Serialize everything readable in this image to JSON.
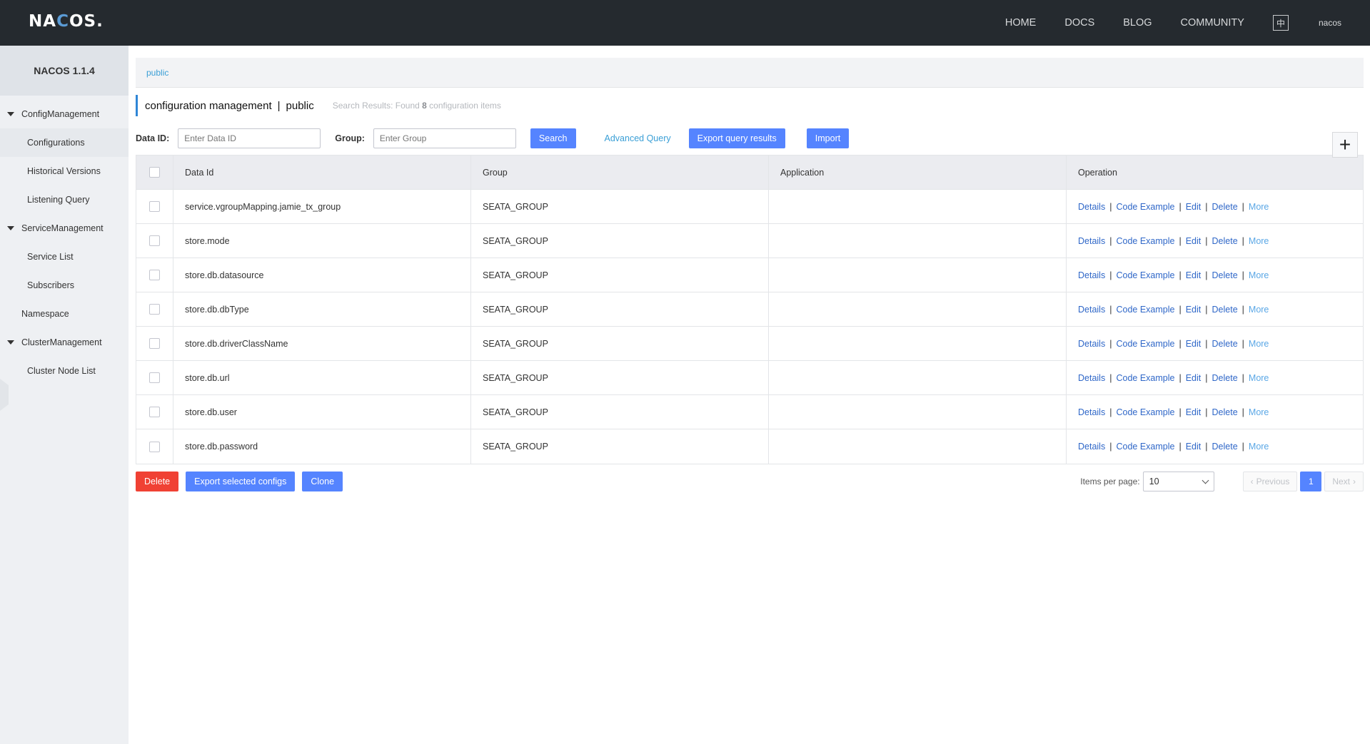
{
  "header": {
    "logo_text_a": "NA",
    "logo_text_b": "C",
    "logo_text_c": "OS.",
    "nav": [
      "HOME",
      "DOCS",
      "BLOG",
      "COMMUNITY"
    ],
    "lang_toggle": "中",
    "user": "nacos"
  },
  "sidebar": {
    "title": "NACOS 1.1.4",
    "groups": {
      "config": "ConfigManagement",
      "service": "ServiceManagement",
      "cluster": "ClusterManagement"
    },
    "items": {
      "configurations": "Configurations",
      "history": "Historical Versions",
      "listening": "Listening Query",
      "service_list": "Service List",
      "subscribers": "Subscribers",
      "namespace": "Namespace",
      "cluster_nodes": "Cluster Node List"
    }
  },
  "breadcrumb": "public",
  "title": {
    "main": "configuration management",
    "separator": "|",
    "namespace": "public",
    "hint_prefix": "Search Results: Found ",
    "hint_count": "8",
    "hint_suffix": " configuration items"
  },
  "filter": {
    "data_id_label": "Data ID:",
    "data_id_placeholder": "Enter Data ID",
    "group_label": "Group:",
    "group_placeholder": "Enter Group",
    "search": "Search",
    "advanced": "Advanced Query",
    "export": "Export query results",
    "import": "Import"
  },
  "table": {
    "columns": [
      "Data Id",
      "Group",
      "Application",
      "Operation"
    ],
    "rows": [
      {
        "data_id": "service.vgroupMapping.jamie_tx_group",
        "group": "SEATA_GROUP",
        "app": ""
      },
      {
        "data_id": "store.mode",
        "group": "SEATA_GROUP",
        "app": ""
      },
      {
        "data_id": "store.db.datasource",
        "group": "SEATA_GROUP",
        "app": ""
      },
      {
        "data_id": "store.db.dbType",
        "group": "SEATA_GROUP",
        "app": ""
      },
      {
        "data_id": "store.db.driverClassName",
        "group": "SEATA_GROUP",
        "app": ""
      },
      {
        "data_id": "store.db.url",
        "group": "SEATA_GROUP",
        "app": ""
      },
      {
        "data_id": "store.db.user",
        "group": "SEATA_GROUP",
        "app": ""
      },
      {
        "data_id": "store.db.password",
        "group": "SEATA_GROUP",
        "app": ""
      }
    ],
    "operations": [
      "Details",
      "Code Example",
      "Edit",
      "Delete",
      "More"
    ]
  },
  "footer": {
    "delete": "Delete",
    "export_selected": "Export selected configs",
    "clone": "Clone",
    "items_per_page_label": "Items per page:",
    "items_per_page": "10",
    "previous": "Previous",
    "current_page": "1",
    "next": "Next"
  },
  "colors": {
    "header_bg": "#252a2f",
    "primary": "#5584ff",
    "danger": "#f04134",
    "link": "#2f67c8"
  }
}
